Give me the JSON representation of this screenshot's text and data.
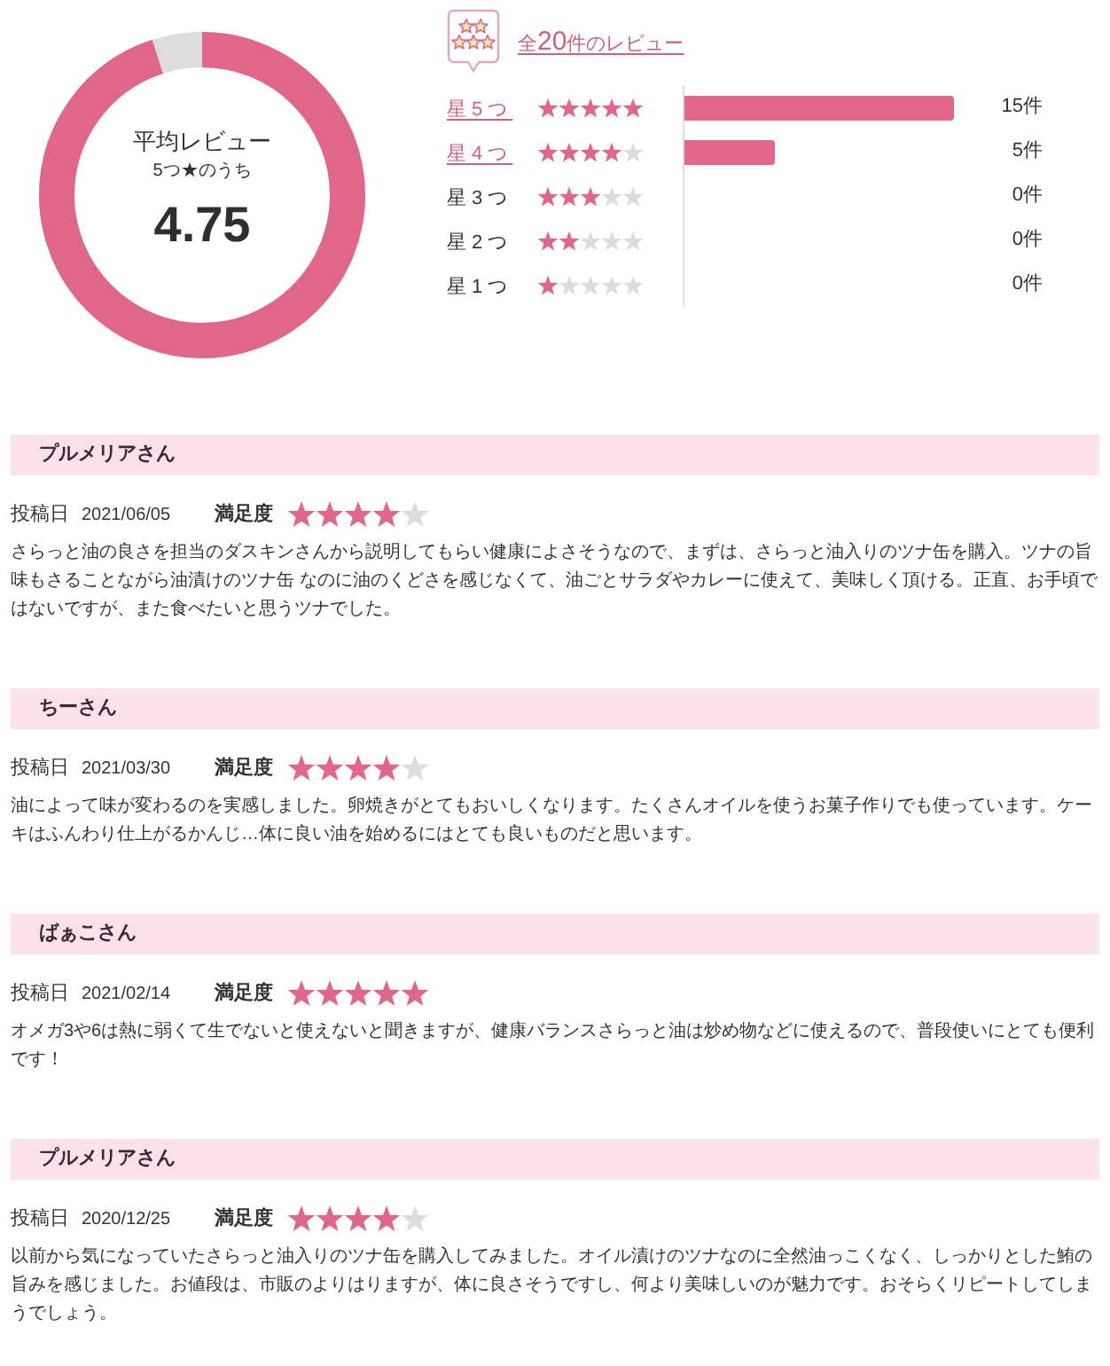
{
  "summary": {
    "title": "平均レビュー",
    "subtitle": "5つ★のうち",
    "average": "4.75",
    "level": 0.95
  },
  "breakdown": {
    "total_link": {
      "prefix": "全",
      "count": "20",
      "suffix": "件のレビュー"
    },
    "rows": [
      {
        "label": "星5つ",
        "linked": true,
        "stars": 5,
        "level": 1,
        "count": "15件"
      },
      {
        "label": "星4つ",
        "linked": true,
        "stars": 4,
        "level": 0.333,
        "count": "5件"
      },
      {
        "label": "星3つ",
        "linked": false,
        "stars": 3,
        "count": "0件"
      },
      {
        "label": "星2つ",
        "linked": false,
        "stars": 2,
        "count": "0件"
      },
      {
        "label": "星1つ",
        "linked": false,
        "stars": 1,
        "count": "0件"
      }
    ]
  },
  "reviews": [
    {
      "name": "プルメリアさん",
      "date_label": "投稿日",
      "date": "2021/06/05",
      "rating_label": "満足度",
      "stars": 4,
      "body": "さらっと油の良さを担当のダスキンさんから説明してもらい健康によさそうなので、まずは、さらっと油入りのツナ缶を購入。ツナの旨味もさることながら油漬けのツナ缶 なのに油のくどさを感じなくて、油ごとサラダやカレーに使えて、美味しく頂ける。正直、お手頃ではないですが、また食べたいと思うツナでした。"
    },
    {
      "name": "ちーさん",
      "date_label": "投稿日",
      "date": "2021/03/30",
      "rating_label": "満足度",
      "stars": 4,
      "body": "油によって味が変わるのを実感しました。卵焼きがとてもおいしくなります。たくさんオイルを使うお菓子作りでも使っています。ケーキはふんわり仕上がるかんじ…体に良い油を始めるにはとても良いものだと思います。"
    },
    {
      "name": "ばぁこさん",
      "date_label": "投稿日",
      "date": "2021/02/14",
      "rating_label": "満足度",
      "stars": 5,
      "body": "オメガ3や6は熱に弱くて生でないと使えないと聞きますが、健康バランスさらっと油は炒め物などに使えるので、普段使いにとても便利です！"
    },
    {
      "name": "プルメリアさん",
      "date_label": "投稿日",
      "date": "2020/12/25",
      "rating_label": "満足度",
      "stars": 4,
      "body": "以前から気になっていたさらっと油入りのツナ缶を購入してみました。オイル漬けのツナなのに全然油っこくなく、しっかりとした鮪の旨みを感じました。お値段は、市販のよりはりますが、体に良さそうですし、何より美味しいのが魅力です。おそらくリピートしてしまうでしょう。"
    }
  ]
}
